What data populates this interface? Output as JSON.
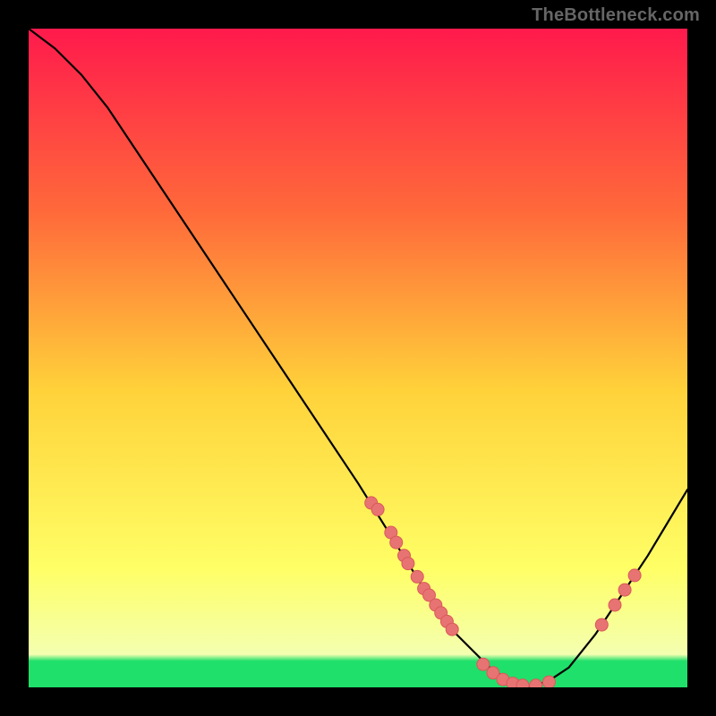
{
  "watermark": "TheBottleneck.com",
  "colors": {
    "background": "#000000",
    "watermark_text": "#666666",
    "curve": "#000000",
    "dot_fill": "#e87373",
    "dot_stroke": "#d85a5a",
    "gradient_top": "#ff1a4c",
    "gradient_mid1": "#ff6a3a",
    "gradient_mid2": "#ffd23a",
    "gradient_mid3": "#ffff66",
    "gradient_band": "#1fe06a",
    "gradient_bottom": "#1fe06a"
  },
  "chart_data": {
    "type": "line",
    "title": "",
    "xlabel": "",
    "ylabel": "",
    "xlim": [
      0,
      100
    ],
    "ylim": [
      0,
      100
    ],
    "curve": [
      {
        "x": 0,
        "y": 100
      },
      {
        "x": 4,
        "y": 97
      },
      {
        "x": 8,
        "y": 93
      },
      {
        "x": 12,
        "y": 88
      },
      {
        "x": 20,
        "y": 76
      },
      {
        "x": 30,
        "y": 61
      },
      {
        "x": 40,
        "y": 46
      },
      {
        "x": 50,
        "y": 31
      },
      {
        "x": 55,
        "y": 23
      },
      {
        "x": 60,
        "y": 15
      },
      {
        "x": 65,
        "y": 8
      },
      {
        "x": 70,
        "y": 3
      },
      {
        "x": 73,
        "y": 1
      },
      {
        "x": 76,
        "y": 0
      },
      {
        "x": 79,
        "y": 1
      },
      {
        "x": 82,
        "y": 3
      },
      {
        "x": 86,
        "y": 8
      },
      {
        "x": 90,
        "y": 14
      },
      {
        "x": 94,
        "y": 20
      },
      {
        "x": 97,
        "y": 25
      },
      {
        "x": 100,
        "y": 30
      }
    ],
    "dots": [
      {
        "x": 52,
        "y": 28
      },
      {
        "x": 53,
        "y": 27
      },
      {
        "x": 55,
        "y": 23.5
      },
      {
        "x": 55.8,
        "y": 22
      },
      {
        "x": 57,
        "y": 20
      },
      {
        "x": 57.6,
        "y": 18.8
      },
      {
        "x": 59,
        "y": 16.8
      },
      {
        "x": 60,
        "y": 15
      },
      {
        "x": 60.8,
        "y": 14
      },
      {
        "x": 61.8,
        "y": 12.5
      },
      {
        "x": 62.6,
        "y": 11.3
      },
      {
        "x": 63.5,
        "y": 10
      },
      {
        "x": 64.3,
        "y": 8.8
      },
      {
        "x": 69,
        "y": 3.5
      },
      {
        "x": 70.5,
        "y": 2.2
      },
      {
        "x": 72,
        "y": 1.2
      },
      {
        "x": 73.5,
        "y": 0.6
      },
      {
        "x": 75,
        "y": 0.3
      },
      {
        "x": 77,
        "y": 0.3
      },
      {
        "x": 79,
        "y": 0.8
      },
      {
        "x": 87,
        "y": 9.5
      },
      {
        "x": 89,
        "y": 12.5
      },
      {
        "x": 90.5,
        "y": 14.8
      },
      {
        "x": 92,
        "y": 17
      }
    ]
  }
}
